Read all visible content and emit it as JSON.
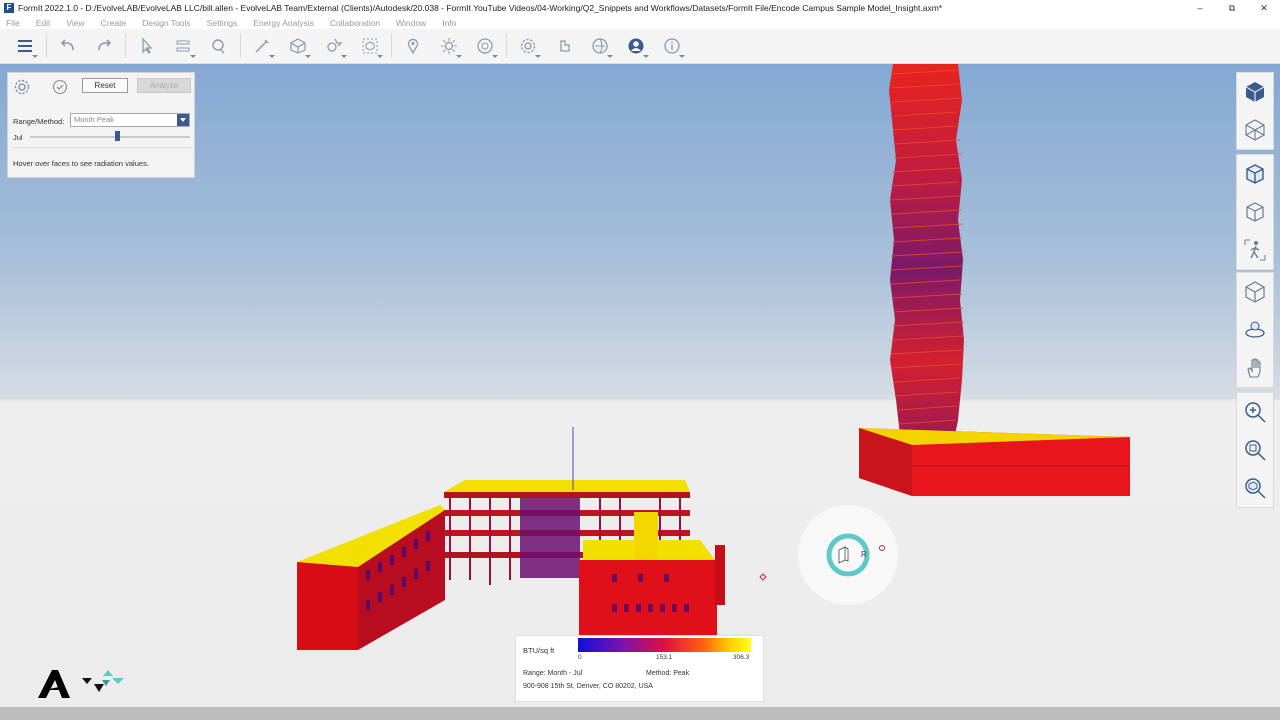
{
  "window": {
    "title": "FormIt 2022.1.0 - D:/EvolveLAB/EvolveLAB LLC/bill.allen - EvolveLAB Team/External (Clients)/Autodesk/20.038 - FormIt YouTube Videos/04-Working/Q2_Snippets and Workflows/Datasets/FormIt File/Encode Campus Sample Model_Insight.axm*",
    "app_icon": "F",
    "minimize": "–",
    "restore": "⧉",
    "close": "✕"
  },
  "menu": [
    "File",
    "Edit",
    "View",
    "Create",
    "Design Tools",
    "Settings",
    "Energy Analysis",
    "Collaboration",
    "Window",
    "Info"
  ],
  "toolbar": {
    "icons": [
      "layers-icon",
      "undo-icon",
      "redo-icon",
      "select-icon",
      "align-icon",
      "tape-measure-icon",
      "draw-line-icon",
      "solid-cube-icon",
      "boolean-icon",
      "group-icon",
      "location-pin-icon",
      "sun-icon",
      "visual-style-icon",
      "settings-gear-icon",
      "plugin-icon",
      "collaboration-icon",
      "user-icon",
      "info-icon"
    ]
  },
  "panel": {
    "reset_label": "Reset",
    "analyze_label": "Analyze",
    "range_method_label": "Range/Method:",
    "range_method_value": "Month Peak",
    "month_label": "Jul",
    "slider_value_month_index": 7,
    "hint": "Hover over faces to see radiation values."
  },
  "legend": {
    "unit": "BTU/sq ft",
    "min": "0",
    "mid": "153.1",
    "max": "306.3",
    "range": "Range: Month - Jul",
    "method": "Method: Peak",
    "address": "900-908 15th St, Denver, CO 80202, USA",
    "colors": [
      "#1010d8",
      "#7a10b0",
      "#e01040",
      "#ff6010",
      "#ffd000",
      "#ffff20"
    ]
  },
  "compass": {
    "label": "R"
  },
  "right_tools": {
    "group1": [
      "view-cube-top-icon",
      "section-box-icon"
    ],
    "group2": [
      "perspective-view-icon",
      "orthographic-view-icon",
      "walk-mode-icon"
    ],
    "group3": [
      "orbit-icon",
      "look-around-icon",
      "pan-icon"
    ],
    "group4": [
      "zoom-in-icon",
      "zoom-extents-icon",
      "zoom-selection-icon"
    ]
  }
}
